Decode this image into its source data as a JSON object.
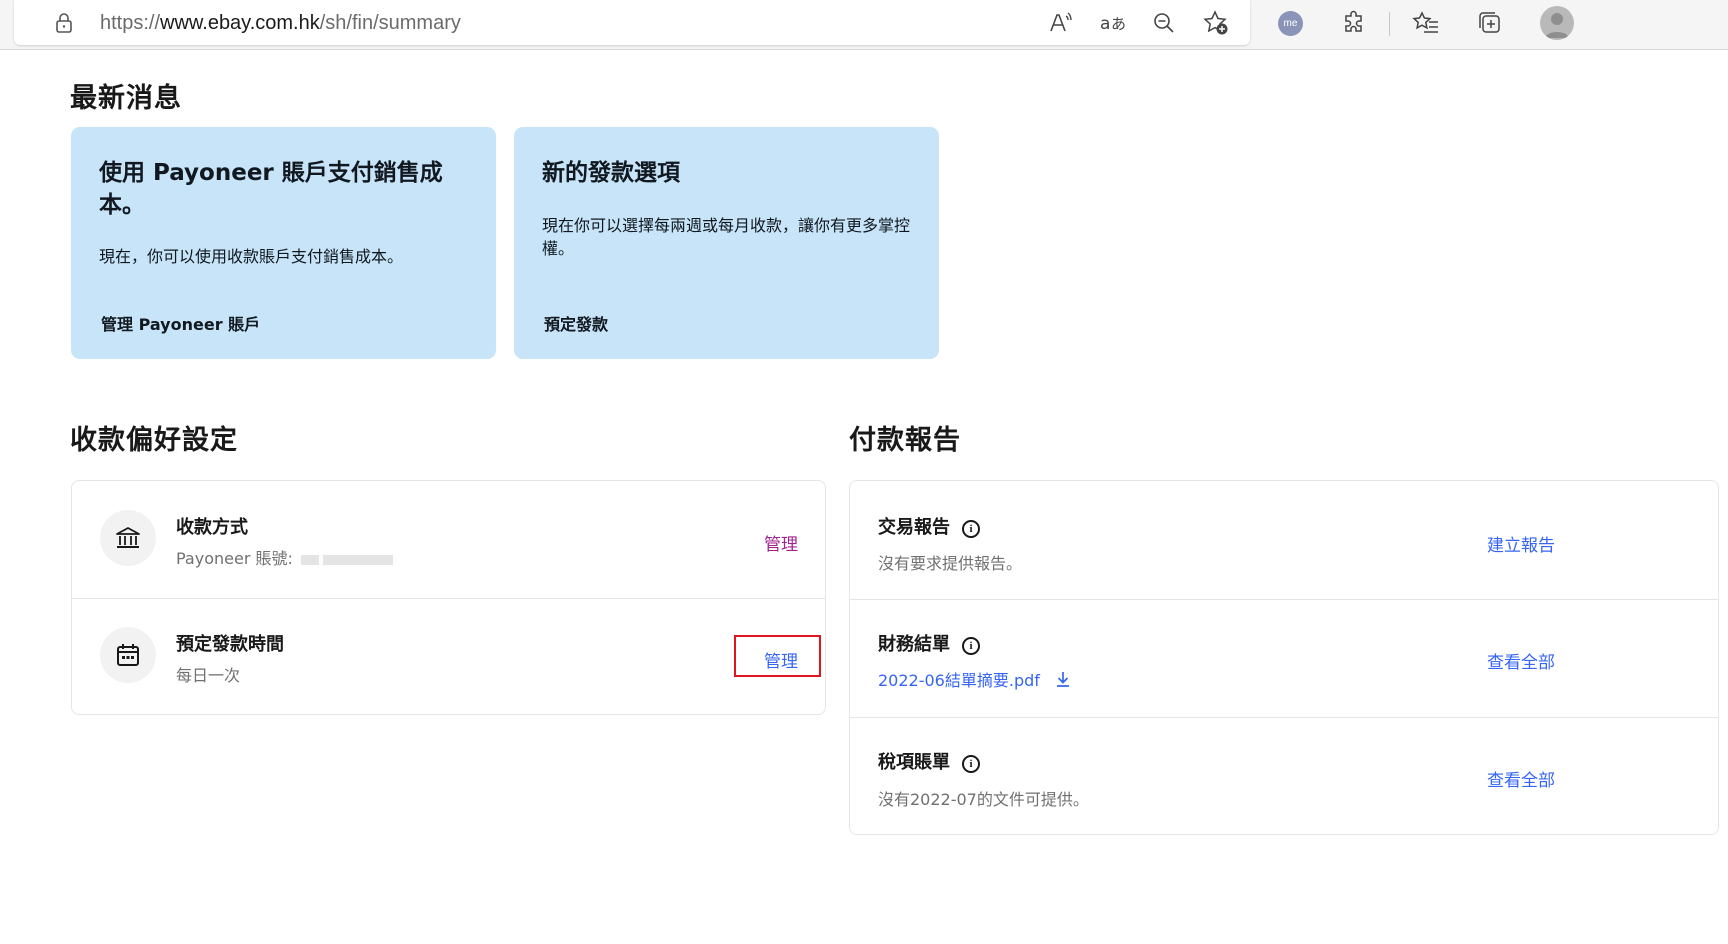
{
  "browser": {
    "url_scheme": "https://",
    "url_host": "www.ebay.com.hk",
    "url_path": "/sh/fin/summary",
    "me_avatar_text": "me"
  },
  "news": {
    "heading": "最新消息",
    "cards": [
      {
        "title": "使用 Payoneer 賬戶支付銷售成本。",
        "body": "現在，你可以使用收款賬戶支付銷售成本。",
        "link": "管理 Payoneer 賬戶"
      },
      {
        "title": "新的發款選項",
        "body": "現在你可以選擇每兩週或每月收款，讓你有更多掌控權。",
        "link": "預定發款"
      }
    ]
  },
  "preferences": {
    "heading": "收款偏好設定",
    "rows": [
      {
        "icon": "bank-icon",
        "title": "收款方式",
        "subtitle": "Payoneer 賬號:",
        "action": "管理"
      },
      {
        "icon": "calendar-icon",
        "title": "預定發款時間",
        "subtitle": "每日一次",
        "action": "管理"
      }
    ]
  },
  "reports": {
    "heading": "付款報告",
    "rows": [
      {
        "title": "交易報告",
        "subtitle": "沒有要求提供報告。",
        "action": "建立報告"
      },
      {
        "title": "財務結單",
        "file_link": "2022-06結單摘要.pdf",
        "action": "查看全部"
      },
      {
        "title": "稅項賬單",
        "subtitle": "沒有2022-07的文件可提供。",
        "action": "查看全部"
      }
    ]
  },
  "colors": {
    "news_card_bg": "#c7e4f8",
    "link_purple": "#a0238e",
    "link_blue": "#3665f3",
    "highlight_red": "#e0141e"
  }
}
